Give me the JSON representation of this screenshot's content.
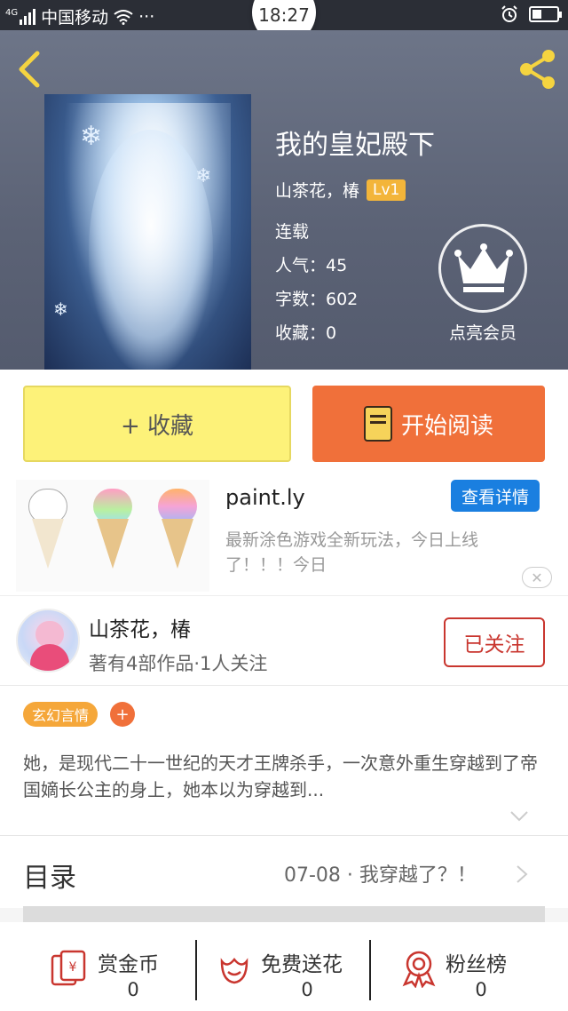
{
  "status_bar": {
    "network": "4G",
    "carrier": "中国移动",
    "more": "···",
    "time": "18:27"
  },
  "book": {
    "title": "我的皇妃殿下",
    "author": "山茶花，椿",
    "level": "Lv1",
    "status": "连载",
    "popularity": "人气：45",
    "word_count": "字数：602",
    "favorites": "收藏：0"
  },
  "vip": {
    "label": "点亮会员"
  },
  "actions": {
    "collect_label": "+ 收藏",
    "read_label": "开始阅读"
  },
  "ad": {
    "title": "paint.ly",
    "detail_button": "查看详情",
    "description": "最新涂色游戏全新玩法，今日上线了！！！今日",
    "close": "✕"
  },
  "author_card": {
    "name": "山茶花，椿",
    "stats": "著有4部作品·1人关注",
    "follow_button": "已关注"
  },
  "tags": {
    "items": [
      "玄幻言情"
    ],
    "add": "+"
  },
  "synopsis": "她，是现代二十一世纪的天才王牌杀手，一次意外重生穿越到了帝国嫡长公主的身上，她本以为穿越到...",
  "toc": {
    "title": "目录",
    "latest": "07-08 · 我穿越了？！"
  },
  "bottom_stats": [
    {
      "label": "赏金币",
      "count": "0",
      "icon": "red-envelope-icon"
    },
    {
      "label": "免费送花",
      "count": "0",
      "icon": "flower-icon"
    },
    {
      "label": "粉丝榜",
      "count": "0",
      "icon": "ribbon-badge-icon"
    }
  ],
  "colors": {
    "hero_bg": "#5b6275",
    "collect_bg": "#fdf279",
    "read_bg": "#f0703a",
    "follow_border": "#c9362f",
    "level_badge": "#f3b53a",
    "ad_button": "#1a7fe0",
    "tag_bg": "#f5a73a"
  }
}
